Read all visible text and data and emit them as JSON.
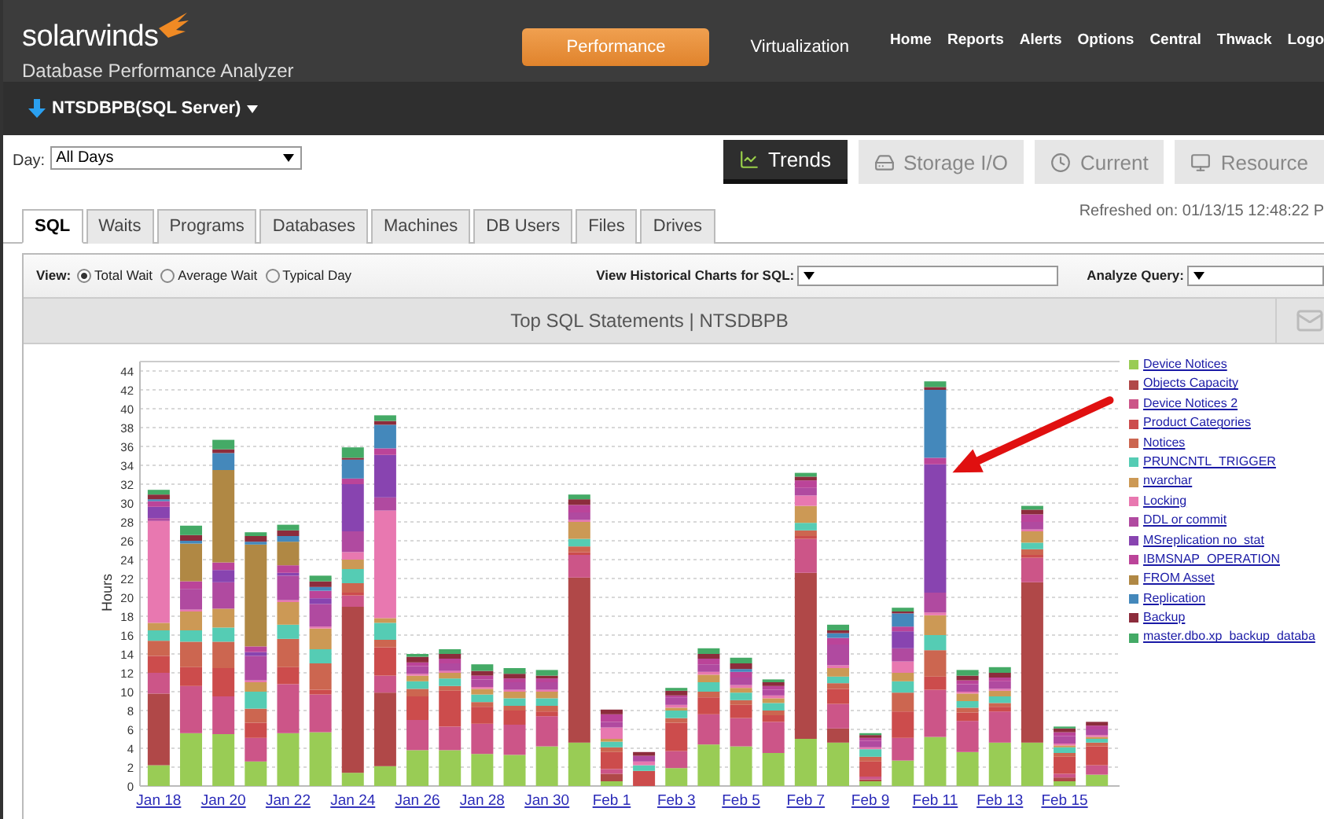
{
  "header": {
    "logo_text": "solarwinds",
    "product_name": "Database Performance Analyzer",
    "modes": [
      {
        "label": "Performance",
        "selected": true
      },
      {
        "label": "Virtualization",
        "selected": false
      }
    ],
    "nav": [
      "Home",
      "Reports",
      "Alerts",
      "Options",
      "Central",
      "Thwack",
      "Logo"
    ]
  },
  "server": {
    "name": "NTSDBPB(SQL Server)"
  },
  "day_filter": {
    "label": "Day:",
    "value": "All Days"
  },
  "views": [
    {
      "label": "Trends",
      "selected": true
    },
    {
      "label": "Storage I/O",
      "selected": false
    },
    {
      "label": "Current",
      "selected": false
    },
    {
      "label": "Resource",
      "selected": false
    }
  ],
  "tabs": [
    {
      "label": "SQL",
      "selected": true
    },
    {
      "label": "Waits",
      "selected": false
    },
    {
      "label": "Programs",
      "selected": false
    },
    {
      "label": "Databases",
      "selected": false
    },
    {
      "label": "Machines",
      "selected": false
    },
    {
      "label": "DB Users",
      "selected": false
    },
    {
      "label": "Files",
      "selected": false
    },
    {
      "label": "Drives",
      "selected": false
    }
  ],
  "refreshed": "Refreshed on: 01/13/15 12:48:22 P",
  "toolbar": {
    "view_label": "View:",
    "view_options": [
      {
        "label": "Total Wait",
        "selected": true
      },
      {
        "label": "Average Wait",
        "selected": false
      },
      {
        "label": "Typical Day",
        "selected": false
      }
    ],
    "history_label": "View Historical Charts for SQL:",
    "analyze_label": "Analyze Query:"
  },
  "panel_title": "Top SQL Statements | NTSDBPB",
  "chart_data": {
    "type": "bar",
    "stacked": true,
    "ylabel": "Hours",
    "ylim": [
      0,
      45
    ],
    "yticks": [
      0,
      2,
      4,
      6,
      8,
      10,
      12,
      14,
      16,
      18,
      20,
      22,
      24,
      26,
      28,
      30,
      32,
      34,
      36,
      38,
      40,
      42,
      44
    ],
    "grid": true,
    "categories": [
      "Jan 18",
      null,
      "Jan 20",
      null,
      "Jan 22",
      null,
      "Jan 24",
      null,
      "Jan 26",
      null,
      "Jan 28",
      null,
      "Jan 30",
      null,
      "Feb 1",
      null,
      "Feb 3",
      null,
      "Feb 5",
      null,
      "Feb 7",
      null,
      "Feb 9",
      null,
      "Feb 11",
      null,
      "Feb 13",
      null,
      "Feb 15",
      null
    ],
    "series": [
      {
        "name": "Device Notices",
        "color": "#99cc55",
        "values": [
          2.2,
          5.6,
          5.5,
          2.6,
          5.6,
          5.7,
          1.4,
          2.1,
          3.8,
          3.8,
          3.4,
          3.3,
          4.2,
          4.6,
          0.5,
          0,
          1.9,
          4.4,
          4.2,
          3.5,
          5,
          4.6,
          0.5,
          2.7,
          5.2,
          3.6,
          4.6,
          4.6,
          0.5,
          1.2
        ]
      },
      {
        "name": "Objects Capacity",
        "color": "#b04848",
        "values": [
          7.6,
          0,
          0,
          0,
          0,
          0,
          17.6,
          7.8,
          0,
          0,
          0,
          0,
          0,
          17.5,
          0.8,
          0,
          0,
          0,
          0,
          0,
          17.6,
          1.5,
          0.2,
          0,
          0,
          0,
          0,
          17,
          0.4,
          0
        ]
      },
      {
        "name": "Device Notices 2",
        "color": "#cc5588",
        "values": [
          2.2,
          5,
          4,
          2.5,
          5.2,
          4,
          1.2,
          1.8,
          3.2,
          2.5,
          3.2,
          3.2,
          3.2,
          2.4,
          0.5,
          0,
          1.8,
          3.2,
          3,
          3.3,
          3.6,
          2.6,
          0.3,
          2.4,
          5,
          3.3,
          3.3,
          2.6,
          0.4,
          1
        ]
      },
      {
        "name": "Product Categories",
        "color": "#cc4c4c",
        "values": [
          1.8,
          2,
          3,
          1.6,
          1.8,
          0.5,
          0.3,
          3,
          2.5,
          3.8,
          1.8,
          1.5,
          0.5,
          0.3,
          1.8,
          1.6,
          3,
          1.8,
          1.4,
          0.7,
          0.3,
          1.6,
          1.6,
          2.8,
          1.4,
          0.9,
          0.5,
          0.3,
          1.8,
          2
        ]
      },
      {
        "name": "Notices",
        "color": "#cc6650",
        "values": [
          1.6,
          2.7,
          2.8,
          1.5,
          3,
          2.8,
          1,
          0.8,
          0.8,
          0.5,
          0.5,
          0.5,
          0.6,
          0.6,
          0.5,
          0,
          0.5,
          0.6,
          0.5,
          0.5,
          0.6,
          0.6,
          0.5,
          2,
          2.8,
          0.5,
          0.4,
          0.6,
          0.4,
          0.4
        ]
      },
      {
        "name": "PRUNCNTL_TRIGGER",
        "color": "#55ccb4",
        "values": [
          1.1,
          1.2,
          1.5,
          1.8,
          1.5,
          1.5,
          1.5,
          1.8,
          0.8,
          0.8,
          0.8,
          0.8,
          0.8,
          0.8,
          0.6,
          0.6,
          0.8,
          1,
          0.8,
          0.8,
          0.8,
          0.7,
          0.8,
          1.2,
          1.6,
          0.7,
          0.7,
          0.7,
          0.6,
          0.4
        ]
      },
      {
        "name": "nvarchar",
        "color": "#cc9955",
        "values": [
          0.8,
          2,
          2,
          1,
          2.4,
          2.2,
          1,
          0.5,
          0.6,
          0.6,
          0.6,
          0.7,
          0.7,
          1.8,
          0.3,
          0,
          0.3,
          0.8,
          0.5,
          0.5,
          1.8,
          0.9,
          0,
          0.9,
          2.1,
          0.8,
          0.6,
          1.2,
          0.2,
          0.2
        ]
      },
      {
        "name": "Locking",
        "color": "#e878b0",
        "values": [
          10.8,
          0.2,
          0,
          0.2,
          0.2,
          0.2,
          0.8,
          11.4,
          0.2,
          0.2,
          0.2,
          0.2,
          0.2,
          0.2,
          1.2,
          0.4,
          0.3,
          0.3,
          0.3,
          0.3,
          1.1,
          0.3,
          0.2,
          1.2,
          0.3,
          0.2,
          0.2,
          0.2,
          0.2,
          0.2
        ]
      },
      {
        "name": "DDL or  commit",
        "color": "#b04aa0",
        "values": [
          0.3,
          2.2,
          2.8,
          2.6,
          2.6,
          2.4,
          2.2,
          1.4,
          0.8,
          0.8,
          0.8,
          0.8,
          0.8,
          0.8,
          0.6,
          0.6,
          0.8,
          0.8,
          0.8,
          0.6,
          0.8,
          2.2,
          0.7,
          1.4,
          2.1,
          0.8,
          0.8,
          0.8,
          0.8,
          0.6
        ]
      },
      {
        "name": "MSreplication no_stat",
        "color": "#8844b0",
        "values": [
          1.2,
          0,
          1.3,
          0.4,
          0.3,
          0.6,
          5,
          4.5,
          0,
          0,
          0,
          0,
          0,
          0,
          0,
          0,
          0,
          0,
          0,
          0,
          0,
          0,
          0,
          1.8,
          13.6,
          0,
          0,
          0,
          0,
          0
        ]
      },
      {
        "name": "IBMSNAP_OPERATION",
        "color": "#bb4499",
        "values": [
          0.6,
          0.8,
          0.8,
          0.6,
          0.8,
          0.8,
          0.6,
          0.7,
          0.4,
          0.5,
          0.4,
          0.4,
          0.4,
          0.8,
          0.8,
          0,
          0.2,
          0.6,
          0.6,
          0.4,
          0.8,
          0.7,
          0.3,
          0.5,
          0.7,
          0.4,
          0.4,
          0.8,
          0.4,
          0.4
        ]
      },
      {
        "name": "FROM Asset",
        "color": "#b08844",
        "values": [
          0,
          4,
          9.8,
          10.8,
          2.5,
          0,
          0,
          0,
          0,
          0,
          0,
          0,
          0,
          0,
          0,
          0,
          0,
          0,
          0,
          0,
          0,
          0,
          0,
          0,
          0,
          0,
          0,
          0,
          0,
          0
        ]
      },
      {
        "name": "Replication",
        "color": "#4488bb",
        "values": [
          0.2,
          0.3,
          1.8,
          0.3,
          0.6,
          0.4,
          2,
          2.5,
          0,
          0,
          0,
          0,
          0,
          0,
          0,
          0,
          0,
          0,
          0.3,
          0,
          0,
          0.5,
          0,
          1.4,
          7.2,
          0,
          0,
          0,
          0,
          0
        ]
      },
      {
        "name": "Backup",
        "color": "#8c2c3c",
        "values": [
          0.5,
          0.6,
          0.4,
          0.6,
          0.6,
          0.6,
          0.2,
          0.4,
          0.6,
          0.5,
          0.5,
          0.5,
          0.3,
          0.6,
          0.5,
          0.4,
          0.5,
          0.5,
          0.6,
          0.4,
          0.4,
          0.3,
          0.3,
          0.2,
          0.3,
          0.5,
          0.5,
          0.5,
          0.4,
          0.4
        ]
      },
      {
        "name": "master.dbo.xp_backup_databa",
        "color": "#44aa66",
        "values": [
          0.5,
          1,
          1,
          0.4,
          0.6,
          0.6,
          1.1,
          0.6,
          0.3,
          0.5,
          0.7,
          0.6,
          0.6,
          0.5,
          0,
          0,
          0.3,
          0.6,
          0.6,
          0.3,
          0.4,
          0.6,
          0.2,
          0.4,
          0.6,
          0.6,
          0.6,
          0.4,
          0.2,
          0
        ]
      }
    ]
  }
}
